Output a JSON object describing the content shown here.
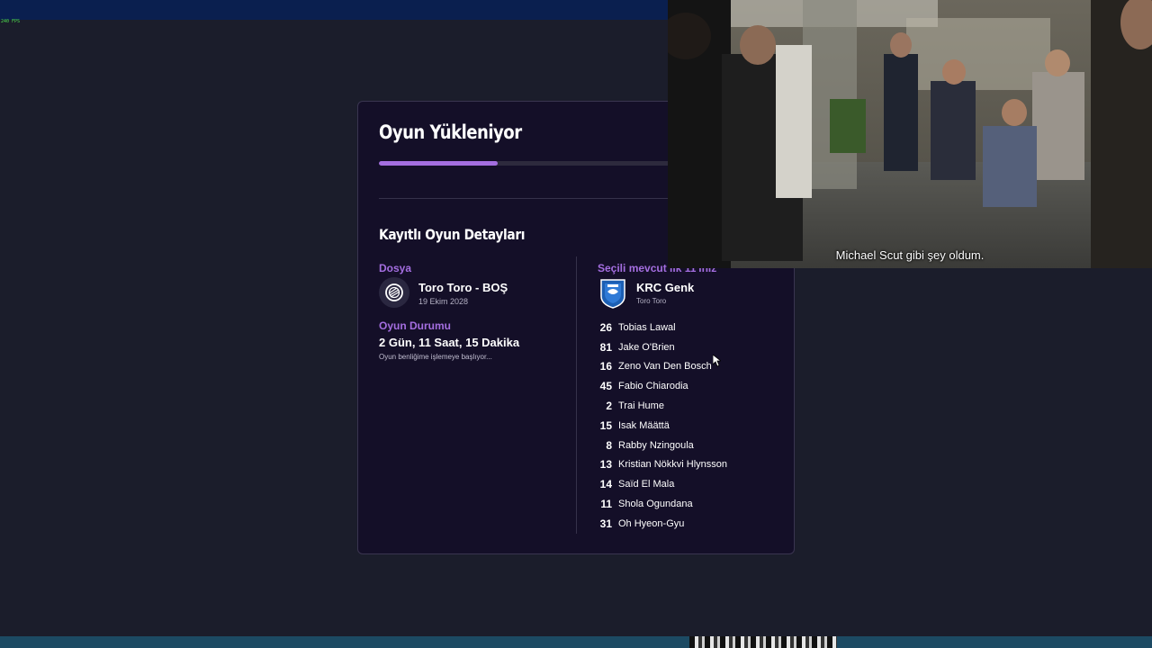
{
  "overlay": {
    "fps_label": "240 FPS"
  },
  "loading": {
    "title": "Oyun Yükleniyor",
    "progress": 0.3
  },
  "details": {
    "title": "Kayıtlı Oyun Detayları",
    "file": {
      "label": "Dosya",
      "name": "Toro Toro - BOŞ",
      "date": "19 Ekim 2028"
    },
    "status": {
      "label": "Oyun Durumu",
      "duration": "2 Gün, 11 Saat, 15 Dakika",
      "note": "Oyun benliğime işlemeye başlıyor..."
    },
    "lineup": {
      "label": "Seçili mevcut ilk 11'iniz",
      "club": "KRC Genk",
      "club_sub": "Toro Toro",
      "players": [
        {
          "num": "26",
          "name": "Tobias Lawal"
        },
        {
          "num": "81",
          "name": "Jake O'Brien"
        },
        {
          "num": "16",
          "name": "Zeno Van Den Bosch"
        },
        {
          "num": "45",
          "name": "Fabio Chiarodia"
        },
        {
          "num": "2",
          "name": "Trai Hume"
        },
        {
          "num": "15",
          "name": "Isak Määttä"
        },
        {
          "num": "8",
          "name": "Rabby Nzingoula"
        },
        {
          "num": "13",
          "name": "Kristian Nökkvi Hlynsson"
        },
        {
          "num": "14",
          "name": "Saïd El Mala"
        },
        {
          "num": "11",
          "name": "Shola Ogundana"
        },
        {
          "num": "31",
          "name": "Oh Hyeon-Gyu"
        }
      ]
    }
  },
  "video": {
    "subtitle": "Michael Scut gibi şey oldum."
  },
  "colors": {
    "accent": "#a46ee0",
    "panel_bg": "#140f28",
    "page_bg": "#1b1d2b"
  }
}
